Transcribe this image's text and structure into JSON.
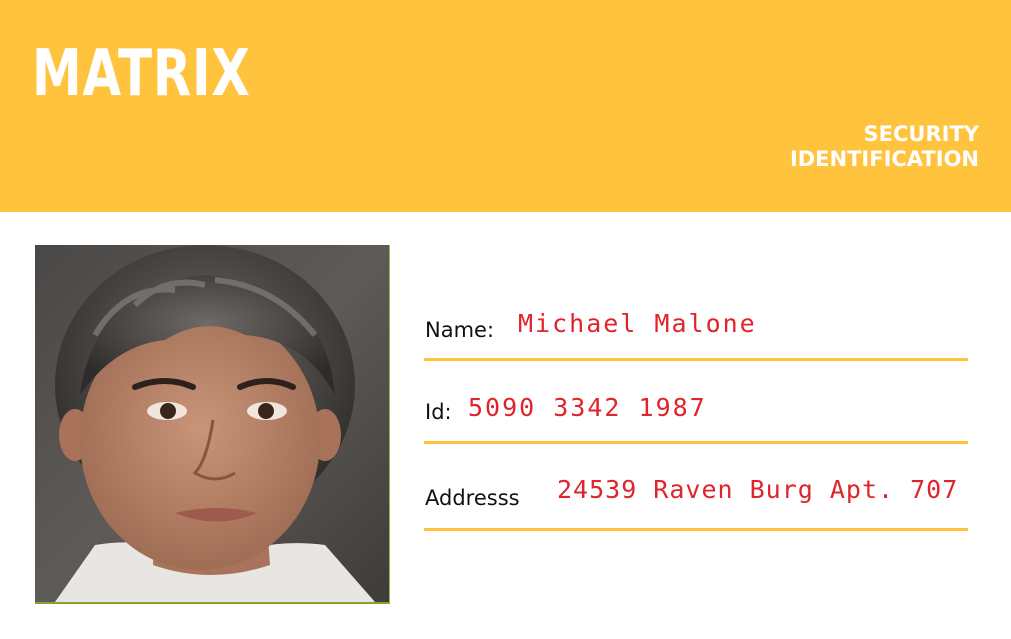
{
  "header": {
    "brand": "MATRIX",
    "title_line1": "SECURITY",
    "title_line2": "IDENTIFICATION",
    "background_color": "#ffc33e"
  },
  "photo": {
    "icon": "id-portrait-photo"
  },
  "fields": {
    "name": {
      "label": "Name:",
      "value": "Michael Malone"
    },
    "id": {
      "label": "Id:",
      "value": "5090 3342 1987"
    },
    "address": {
      "label": "Addresss",
      "value": "24539 Raven Burg Apt. 707"
    }
  },
  "colors": {
    "accent": "#ffc33e",
    "value_text": "#e0242b"
  }
}
